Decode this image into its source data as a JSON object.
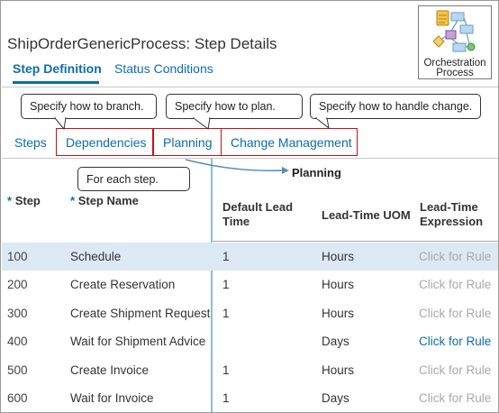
{
  "page": {
    "title": "ShipOrderGenericProcess: Step Details",
    "icon_label_line1": "Orchestration",
    "icon_label_line2": "Process"
  },
  "tabs": {
    "active": "Step Definition",
    "inactive": "Status Conditions"
  },
  "callouts": {
    "branch": "Specify how to branch.",
    "plan": "Specify how to plan.",
    "change": "Specify how to handle change.",
    "each_step": "For each step."
  },
  "subtabs": {
    "steps": "Steps",
    "dependencies": "Dependencies",
    "planning": "Planning",
    "change_management": "Change Management"
  },
  "table": {
    "group_header": "Planning",
    "required_marker": "*",
    "columns": {
      "step": "Step",
      "step_name": "Step Name",
      "lead_time_line1": "Default Lead",
      "lead_time_line2": "Time",
      "uom": "Lead-Time UOM",
      "expression_line1": "Lead-Time",
      "expression_line2": "Expression"
    },
    "rows": [
      {
        "step": "100",
        "name": "Schedule",
        "lead": "1",
        "uom": "Hours",
        "rule": "Click for Rule",
        "rule_enabled": false
      },
      {
        "step": "200",
        "name": "Create Reservation",
        "lead": "1",
        "uom": "Hours",
        "rule": "Click for Rule",
        "rule_enabled": false
      },
      {
        "step": "300",
        "name": "Create Shipment Request",
        "lead": "1",
        "uom": "Hours",
        "rule": "Click for Rule",
        "rule_enabled": false
      },
      {
        "step": "400",
        "name": "Wait for Shipment Advice",
        "lead": "",
        "uom": "Days",
        "rule": "Click for Rule",
        "rule_enabled": true
      },
      {
        "step": "500",
        "name": "Create Invoice",
        "lead": "1",
        "uom": "Hours",
        "rule": "Click for Rule",
        "rule_enabled": false
      },
      {
        "step": "600",
        "name": "Wait for Invoice",
        "lead": "1",
        "uom": "Days",
        "rule": "Click for Rule",
        "rule_enabled": false
      }
    ]
  },
  "colors": {
    "link": "#0c6db0",
    "highlight_box": "#c0141b",
    "selected_row": "#dce9f5",
    "disabled_text": "#a8a8a8"
  }
}
